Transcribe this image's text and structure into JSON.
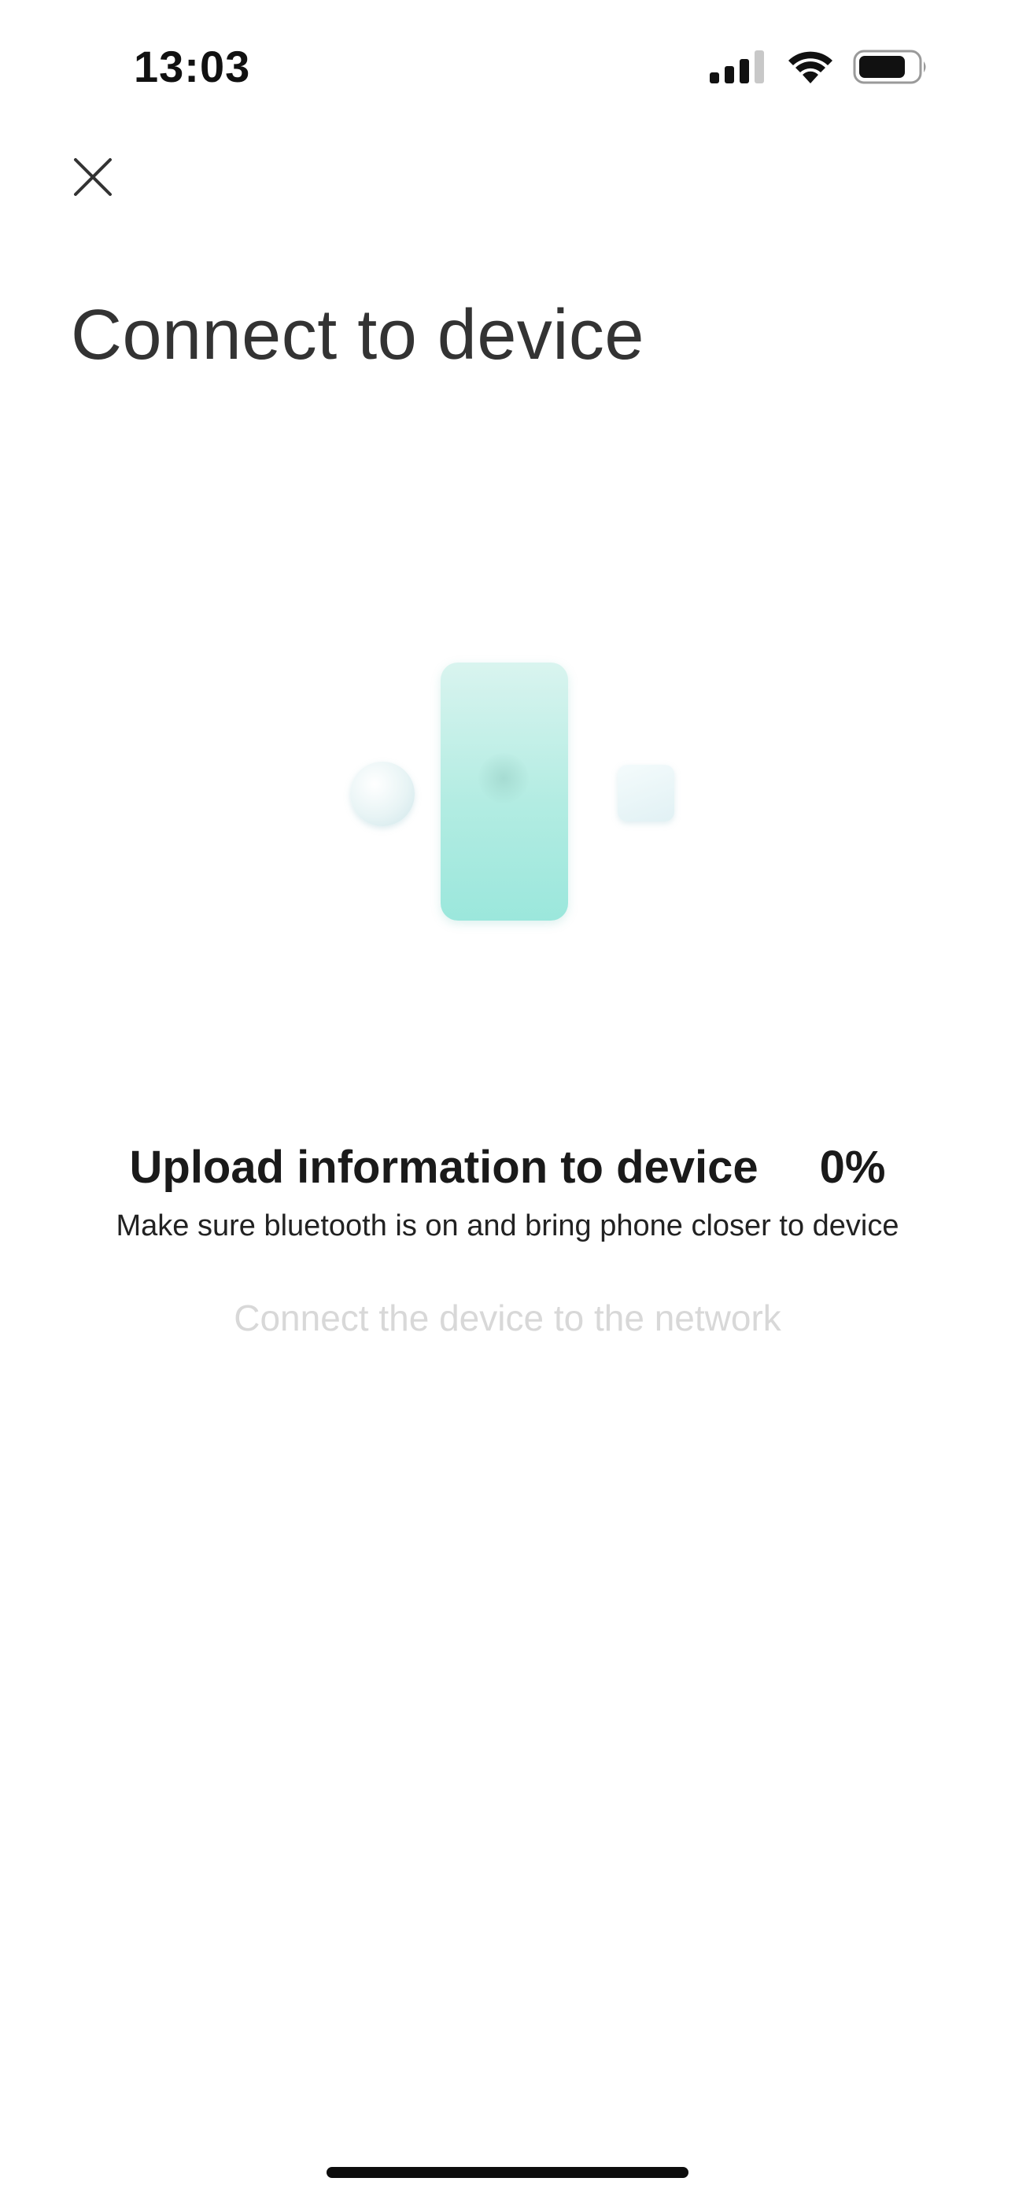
{
  "status_bar": {
    "time": "13:03",
    "signal_icon": "cellular-signal-icon",
    "wifi_icon": "wifi-icon",
    "battery_icon": "battery-icon"
  },
  "header": {
    "close_icon": "close-icon",
    "title": "Connect to device"
  },
  "illustration": {
    "name": "pairing-illustration",
    "colors": {
      "phone_top": "#d9f4ef",
      "phone_bottom": "#9be7dc",
      "accent": "#cfe6ea"
    }
  },
  "progress": {
    "step_title": "Upload information to device",
    "percent": "0%",
    "hint": "Make sure bluetooth is on and bring phone closer to device",
    "next_step": "Connect the device to the network"
  }
}
